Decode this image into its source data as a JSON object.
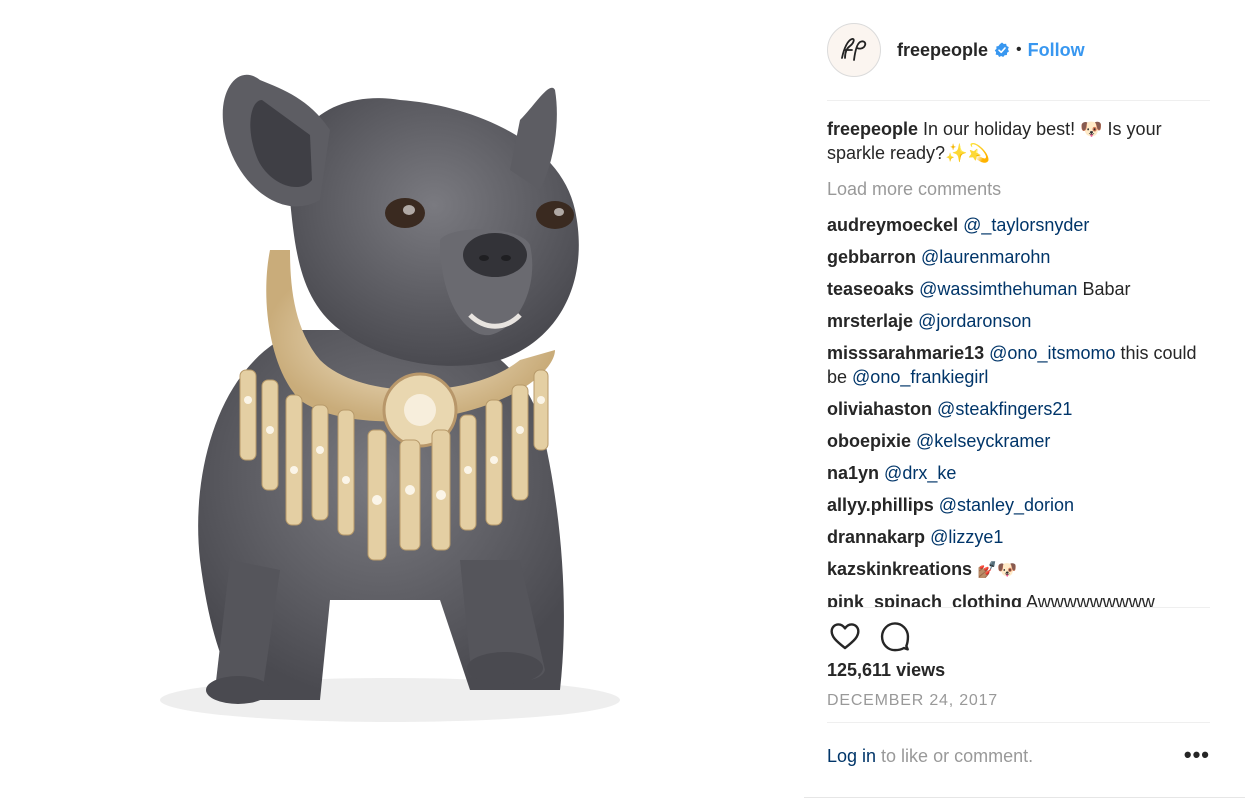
{
  "post": {
    "image_alt": "French bulldog wearing jeweled collar",
    "header": {
      "username": "freepeople",
      "follow_label": "Follow",
      "dot": "•",
      "verified_icon": "verified-badge-icon",
      "avatar_monogram": "fp"
    },
    "caption": {
      "username": "freepeople",
      "text": "In our holiday best! 🐶 Is your sparkle ready?✨💫"
    },
    "load_more_label": "Load more comments",
    "comments": [
      {
        "username": "audreymoeckel",
        "mention": "@_taylorsnyder",
        "text": ""
      },
      {
        "username": "gebbarron",
        "mention": "@laurenmarohn",
        "text": ""
      },
      {
        "username": "teaseoaks",
        "mention": "@wassimthehuman",
        "text": " Babar"
      },
      {
        "username": "mrsterlaje",
        "mention": "@jordaronson",
        "text": ""
      },
      {
        "username": "misssarahmarie13",
        "mention": "@ono_itsmomo",
        "text": " this could be ",
        "mention2": "@ono_frankiegirl"
      },
      {
        "username": "oliviahaston",
        "mention": "@steakfingers21",
        "text": ""
      },
      {
        "username": "oboepixie",
        "mention": "@kelseyckramer",
        "text": ""
      },
      {
        "username": "na1yn",
        "mention": "@drx_ke",
        "text": ""
      },
      {
        "username": "allyy.phillips",
        "mention": "@stanley_dorion",
        "text": ""
      },
      {
        "username": "drannakarp",
        "mention": "@lizzye1",
        "text": ""
      },
      {
        "username": "kazskinkreations",
        "mention": "",
        "text": "💅🏽🐶"
      },
      {
        "username": "pink_spinach_clothing",
        "mention": "",
        "text": " Awwwwwwwww"
      }
    ],
    "actions": {
      "like_icon": "heart-icon",
      "comment_icon": "comment-bubble-icon"
    },
    "views": "125,611 views",
    "date": "DECEMBER 24, 2017",
    "login": {
      "link": "Log in",
      "rest": " to like or comment."
    },
    "more_label": "•••",
    "colors": {
      "link": "#003569",
      "follow": "#3897f0",
      "muted": "#999999",
      "text": "#262626"
    }
  }
}
